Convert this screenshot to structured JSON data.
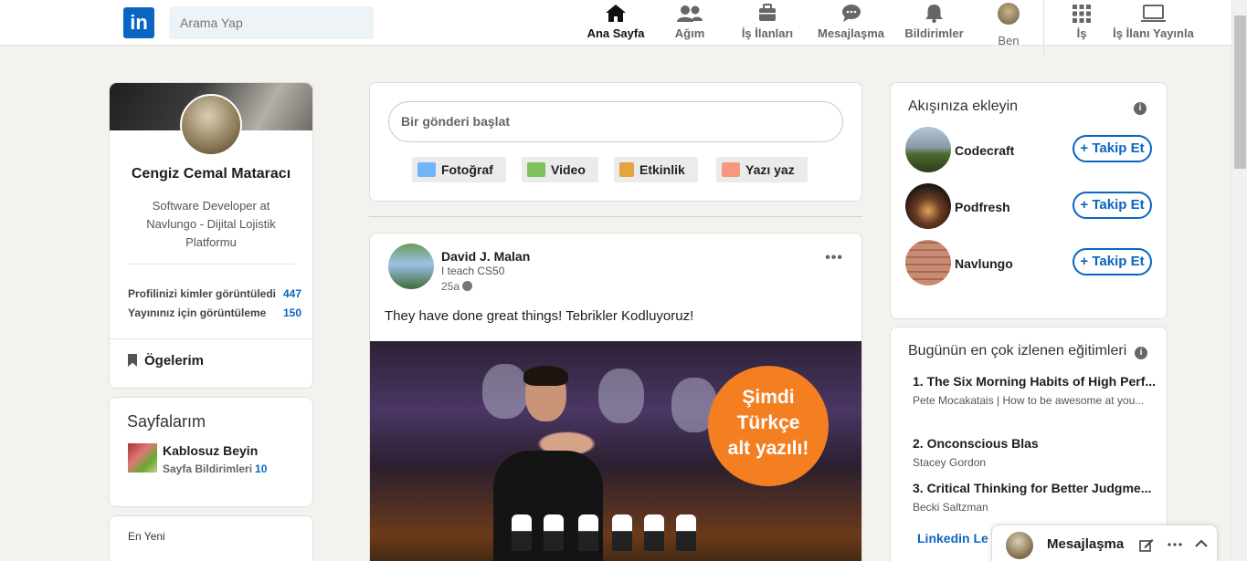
{
  "nav": {
    "logo": "in",
    "search_placeholder": "Arama Yap",
    "items": [
      {
        "label": "Ana Sayfa",
        "icon": "home-icon"
      },
      {
        "label": "Ağım",
        "icon": "network-icon"
      },
      {
        "label": "İş İlanları",
        "icon": "briefcase-icon"
      },
      {
        "label": "Mesajlaşma",
        "icon": "chat-icon"
      },
      {
        "label": "Bildirimler",
        "icon": "bell-icon"
      },
      {
        "label": "Ben",
        "icon": "avatar"
      },
      {
        "label": "İş",
        "icon": "grid-icon"
      },
      {
        "label": "İş İlanı Yayınla",
        "icon": "monitor-icon"
      }
    ]
  },
  "profile": {
    "name": "Cengiz Cemal Mataracı",
    "title": "Software Developer at Navlungo - Dijital Lojistik Platformu",
    "stats": [
      {
        "label": "Profilinizi kimler görüntüledi",
        "value": "447"
      },
      {
        "label": "Yayınınız için görüntüleme",
        "value": "150"
      }
    ],
    "items_label": "Ögelerim"
  },
  "pages": {
    "title": "Sayfalarım",
    "page_name": "Kablosuz Beyin",
    "notif_label": "Sayfa Bildirimleri",
    "notif_count": "10"
  },
  "latest": {
    "label": "En Yeni"
  },
  "composer": {
    "placeholder": "Bir gönderi başlat",
    "buttons": [
      {
        "label": "Fotoğraf",
        "icon": "photo-icon",
        "color": "#70b5f9"
      },
      {
        "label": "Video",
        "icon": "video-icon",
        "color": "#7fc15e"
      },
      {
        "label": "Etkinlik",
        "icon": "calendar-icon",
        "color": "#e7a33e"
      },
      {
        "label": "Yazı yaz",
        "icon": "article-icon",
        "color": "#f5987e"
      }
    ]
  },
  "post": {
    "author": "David J. Malan",
    "headline": "I teach CS50",
    "time": "25a",
    "text": "They have done great things! Tebrikler Kodluyoruz!",
    "badge_line1": "Şimdi",
    "badge_line2": "Türkçe",
    "badge_line3": "alt yazılı!",
    "more": "•••"
  },
  "follow": {
    "title": "Akışınıza ekleyin",
    "button_label": "+ Takip Et",
    "accounts": [
      {
        "name": "Codecraft"
      },
      {
        "name": "Podfresh"
      },
      {
        "name": "Navlungo"
      }
    ]
  },
  "courses": {
    "title": "Bugünün en çok izlenen eğitimleri",
    "list": [
      {
        "title": "1. The Six Morning Habits of High Perf...",
        "author": "Pete Mocakatais | How to be awesome at you..."
      },
      {
        "title": "2. Onconscious Blas",
        "author": "Stacey Gordon"
      },
      {
        "title": "3. Critical Thinking for Better Judgme...",
        "author": "Becki Saltzman"
      }
    ],
    "more_link": "Linkedin Le"
  },
  "messaging": {
    "title": "Mesajlaşma"
  }
}
